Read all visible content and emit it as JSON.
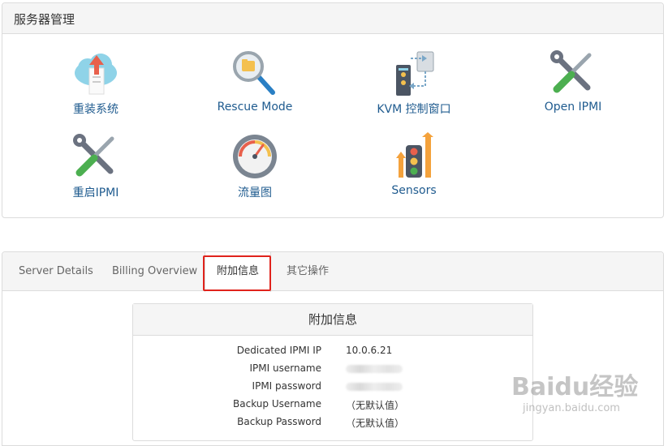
{
  "server_mgmt": {
    "title": "服务器管理",
    "tiles": [
      {
        "label": "重装系统",
        "icon": "cloud-upload-icon"
      },
      {
        "label": "Rescue Mode",
        "icon": "magnifier-icon"
      },
      {
        "label": "KVM 控制窗口",
        "icon": "kvm-console-icon"
      },
      {
        "label": "Open IPMI",
        "icon": "tools-icon"
      },
      {
        "label": "重启IPMI",
        "icon": "tools-icon"
      },
      {
        "label": "流量图",
        "icon": "gauge-icon"
      },
      {
        "label": "Sensors",
        "icon": "traffic-light-icon"
      }
    ]
  },
  "tabs": [
    {
      "label": "Server Details"
    },
    {
      "label": "Billing Overview"
    },
    {
      "label": "附加信息",
      "active": true
    },
    {
      "label": "其它操作"
    }
  ],
  "info": {
    "title": "附加信息",
    "rows": [
      {
        "key": "Dedicated IPMI IP",
        "value": "10.0.6.21"
      },
      {
        "key": "IPMI username",
        "value": ""
      },
      {
        "key": "IPMI password",
        "value": ""
      },
      {
        "key": "Backup Username",
        "value": "（无默认值）"
      },
      {
        "key": "Backup Password",
        "value": "（无默认值）"
      }
    ]
  },
  "watermark": {
    "main": "Baidu经验",
    "sub": "jingyan.baidu.com"
  },
  "colors": {
    "link": "#1f5b8f",
    "highlight": "#e0231c",
    "header_bg": "#f5f5f5",
    "border": "#dcdcdc"
  }
}
